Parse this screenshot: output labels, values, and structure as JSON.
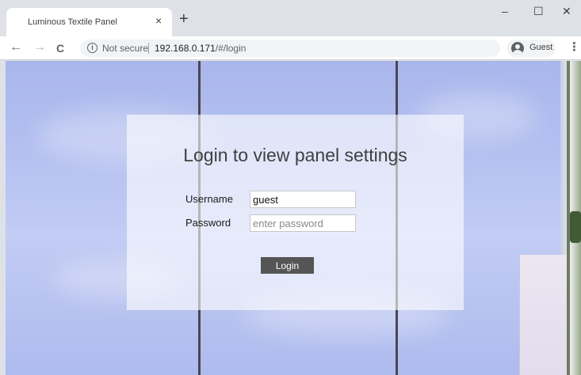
{
  "browser": {
    "tab_title": "Luminous Textile Panel",
    "tab_close": "×",
    "new_tab": "+",
    "window_controls": {
      "minimize": "–",
      "maximize": "☐",
      "close": "✕"
    },
    "nav": {
      "back": "←",
      "forward": "→",
      "reload": "C"
    },
    "security_label": "Not secure",
    "url_host": "192.168.0.171",
    "url_path": "/#/login",
    "profile_label": "Guest",
    "menu": "⋮"
  },
  "login": {
    "title": "Login to view panel settings",
    "username_label": "Username",
    "username_value": "guest",
    "password_label": "Password",
    "password_placeholder": "enter password",
    "submit_label": "Login"
  },
  "colors": {
    "panel_bg": "rgba(255,255,255,0.60)",
    "button_bg": "#555555",
    "sky": "#b4c0f0"
  },
  "icons": {
    "info": "info-icon",
    "profile": "user-avatar-icon"
  }
}
